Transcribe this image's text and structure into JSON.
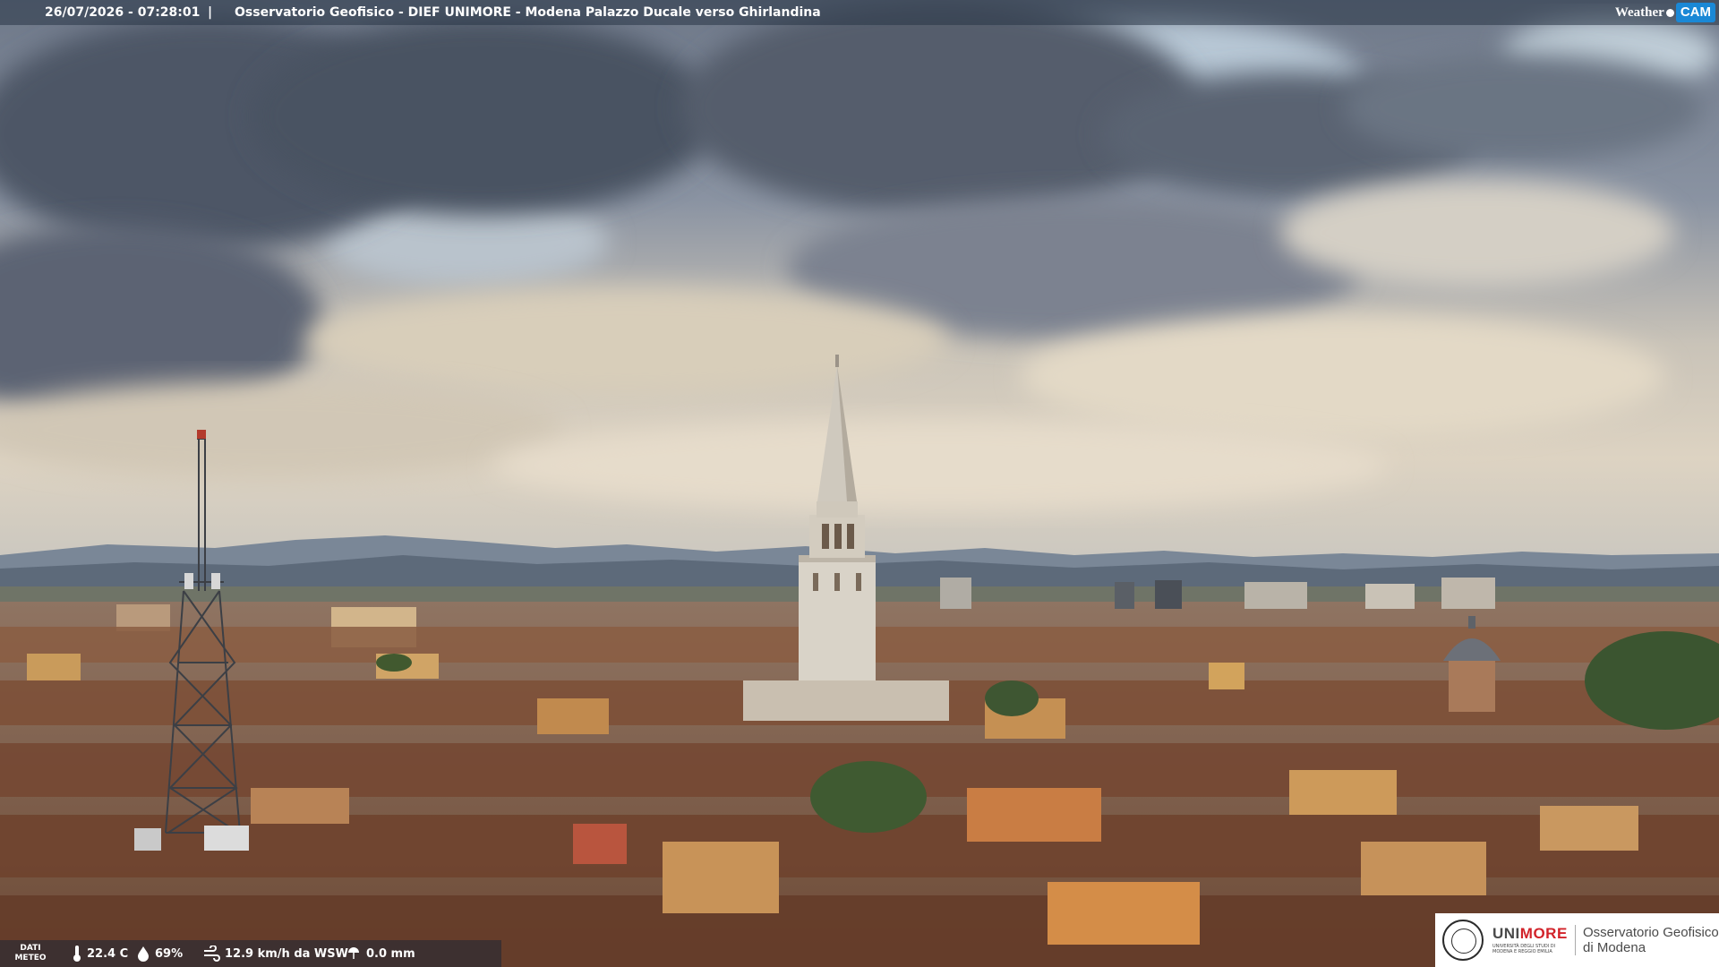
{
  "header": {
    "datetime": "26/07/2026 - 07:28:01",
    "separator": "|",
    "caption": "Osservatorio Geofisico - DIEF UNIMORE - Modena Palazzo Ducale verso Ghirlandina"
  },
  "watermark": {
    "brand_text": "Weather",
    "brand_badge": "CAM",
    "badge_color": "#1a88d6"
  },
  "weather_bar": {
    "label_line1": "DATI",
    "label_line2": "METEO",
    "temperature": "22.4 C",
    "humidity": "69%",
    "wind": "12.9 km/h da WSW",
    "rain": "0.0 mm",
    "icons": [
      "thermometer-icon",
      "humidity-drop-icon",
      "wind-icon",
      "rain-icon"
    ]
  },
  "logo": {
    "uni_part1": "UNI",
    "uni_part2": "MORE",
    "uni_sub_line1": "UNIVERSITÀ DEGLI STUDI DI",
    "uni_sub_line2": "MODENA E REGGIO EMILIA",
    "observatory_line1": "Osservatorio Geofisico",
    "observatory_line2": "di Modena",
    "accent_color": "#d2232a"
  }
}
